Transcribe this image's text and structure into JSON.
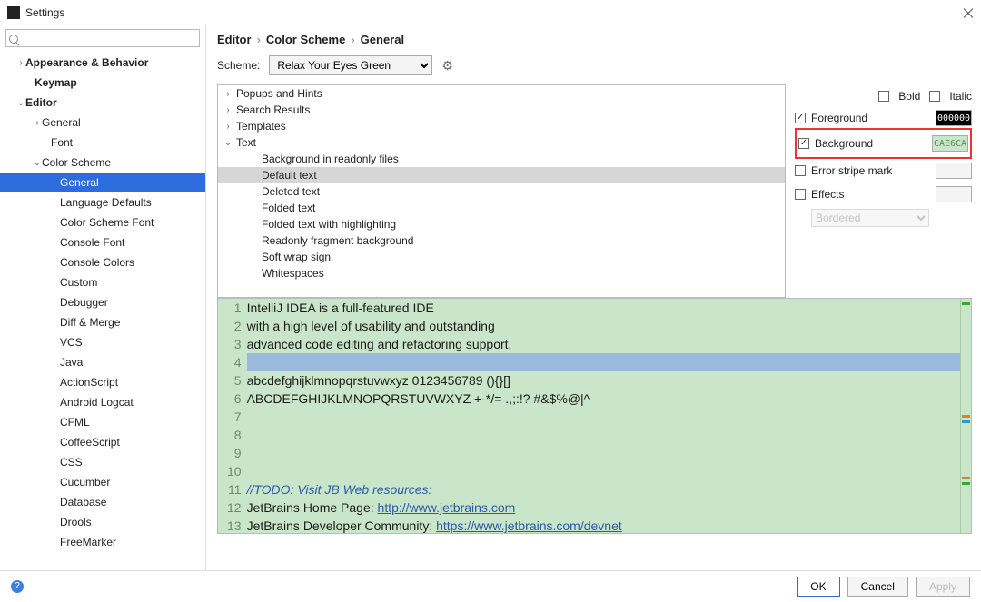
{
  "window": {
    "title": "Settings"
  },
  "search": {
    "placeholder": ""
  },
  "sidebar": [
    {
      "label": "Appearance & Behavior",
      "indent": 18,
      "arrow": "›",
      "bold": true
    },
    {
      "label": "Keymap",
      "indent": 28,
      "arrow": "",
      "bold": true
    },
    {
      "label": "Editor",
      "indent": 18,
      "arrow": "⌄",
      "bold": true
    },
    {
      "label": "General",
      "indent": 36,
      "arrow": "›",
      "bold": false
    },
    {
      "label": "Font",
      "indent": 46,
      "arrow": "",
      "bold": false
    },
    {
      "label": "Color Scheme",
      "indent": 36,
      "arrow": "⌄",
      "bold": false
    },
    {
      "label": "General",
      "indent": 56,
      "arrow": "",
      "bold": false,
      "selected": true
    },
    {
      "label": "Language Defaults",
      "indent": 56,
      "arrow": "",
      "bold": false
    },
    {
      "label": "Color Scheme Font",
      "indent": 56,
      "arrow": "",
      "bold": false
    },
    {
      "label": "Console Font",
      "indent": 56,
      "arrow": "",
      "bold": false
    },
    {
      "label": "Console Colors",
      "indent": 56,
      "arrow": "",
      "bold": false
    },
    {
      "label": "Custom",
      "indent": 56,
      "arrow": "",
      "bold": false
    },
    {
      "label": "Debugger",
      "indent": 56,
      "arrow": "",
      "bold": false
    },
    {
      "label": "Diff & Merge",
      "indent": 56,
      "arrow": "",
      "bold": false
    },
    {
      "label": "VCS",
      "indent": 56,
      "arrow": "",
      "bold": false
    },
    {
      "label": "Java",
      "indent": 56,
      "arrow": "",
      "bold": false
    },
    {
      "label": "ActionScript",
      "indent": 56,
      "arrow": "",
      "bold": false
    },
    {
      "label": "Android Logcat",
      "indent": 56,
      "arrow": "",
      "bold": false
    },
    {
      "label": "CFML",
      "indent": 56,
      "arrow": "",
      "bold": false
    },
    {
      "label": "CoffeeScript",
      "indent": 56,
      "arrow": "",
      "bold": false
    },
    {
      "label": "CSS",
      "indent": 56,
      "arrow": "",
      "bold": false
    },
    {
      "label": "Cucumber",
      "indent": 56,
      "arrow": "",
      "bold": false
    },
    {
      "label": "Database",
      "indent": 56,
      "arrow": "",
      "bold": false
    },
    {
      "label": "Drools",
      "indent": 56,
      "arrow": "",
      "bold": false
    },
    {
      "label": "FreeMarker",
      "indent": 56,
      "arrow": "",
      "bold": false
    }
  ],
  "breadcrumb": [
    "Editor",
    "Color Scheme",
    "General"
  ],
  "scheme": {
    "label": "Scheme:",
    "value": "Relax Your Eyes Green"
  },
  "detail": [
    {
      "label": "Popups and Hints",
      "indent": 6,
      "arrow": "›"
    },
    {
      "label": "Search Results",
      "indent": 6,
      "arrow": "›"
    },
    {
      "label": "Templates",
      "indent": 6,
      "arrow": "›"
    },
    {
      "label": "Text",
      "indent": 6,
      "arrow": "⌄"
    },
    {
      "label": "Background in readonly files",
      "indent": 34,
      "arrow": ""
    },
    {
      "label": "Default text",
      "indent": 34,
      "arrow": "",
      "selected": true
    },
    {
      "label": "Deleted text",
      "indent": 34,
      "arrow": ""
    },
    {
      "label": "Folded text",
      "indent": 34,
      "arrow": ""
    },
    {
      "label": "Folded text with highlighting",
      "indent": 34,
      "arrow": ""
    },
    {
      "label": "Readonly fragment background",
      "indent": 34,
      "arrow": ""
    },
    {
      "label": "Soft wrap sign",
      "indent": 34,
      "arrow": ""
    },
    {
      "label": "Whitespaces",
      "indent": 34,
      "arrow": ""
    }
  ],
  "props": {
    "bold": "Bold",
    "italic": "Italic",
    "foreground": {
      "label": "Foreground",
      "checked": true,
      "value": "000000",
      "bg": "#000000",
      "fg": "#ffffff"
    },
    "background": {
      "label": "Background",
      "checked": true,
      "value": "CAE6CA",
      "bg": "#cae6ca",
      "fg": "#5a8a5a"
    },
    "stripe": {
      "label": "Error stripe mark",
      "checked": false
    },
    "effects": {
      "label": "Effects",
      "checked": false
    },
    "effectType": "Bordered"
  },
  "preview": {
    "lines": [
      "IntelliJ IDEA is a full-featured IDE",
      "with a high level of usability and outstanding",
      "advanced code editing and refactoring support.",
      "",
      "abcdefghijklmnopqrstuvwxyz 0123456789 (){}[]",
      "ABCDEFGHIJKLMNOPQRSTUVWXYZ +-*/= .,;:!? #&$%@|^",
      "",
      "",
      "",
      "",
      "//TODO: Visit JB Web resources:",
      "JetBrains Home Page: http://www.jetbrains.com",
      "JetBrains Developer Community: https://www.jetbrains.com/devnet"
    ],
    "link1": "http://www.jetbrains.com",
    "link2": "https://www.jetbrains.com/devnet"
  },
  "footer": {
    "ok": "OK",
    "cancel": "Cancel",
    "apply": "Apply"
  }
}
